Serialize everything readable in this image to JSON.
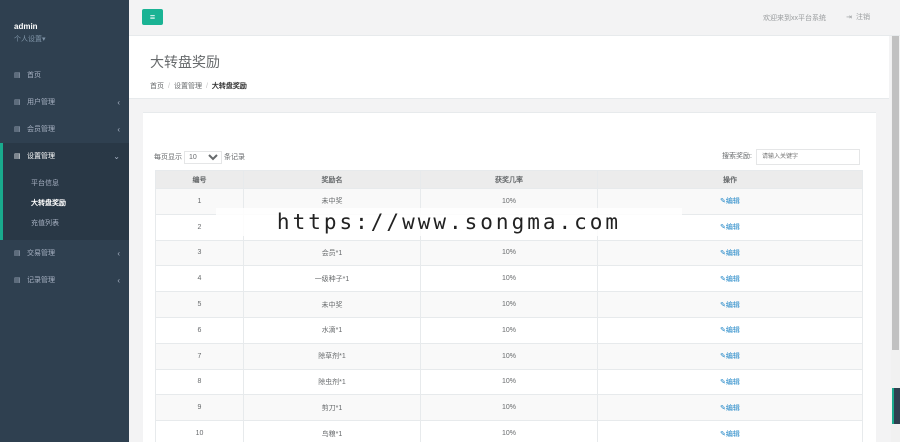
{
  "sidebar": {
    "user": "admin",
    "user_settings": "个人设置▾",
    "items": [
      {
        "label": "首页",
        "has_arrow": false
      },
      {
        "label": "用户管理",
        "has_arrow": true
      },
      {
        "label": "会员管理",
        "has_arrow": true
      },
      {
        "label": "设置管理",
        "active": true
      },
      {
        "label": "交易管理",
        "has_arrow": true
      },
      {
        "label": "记录管理",
        "has_arrow": true
      }
    ],
    "submenu": [
      {
        "label": "平台信息"
      },
      {
        "label": "大转盘奖励",
        "active": true
      },
      {
        "label": "充值列表"
      }
    ],
    "arrow_closed": "‹",
    "arrow_open": "⌄",
    "item_icon": "▤"
  },
  "topbar": {
    "menu_icon": "≡",
    "welcome": "欢迎来到xx平台系统",
    "logout_icon": "⇥",
    "logout": "注销"
  },
  "heading": {
    "title": "大转盘奖励",
    "breadcrumb": [
      "首页",
      "设置管理",
      "大转盘奖励"
    ]
  },
  "table_controls": {
    "length_prefix": "每页显示",
    "length_value": "10",
    "length_suffix": "条记录",
    "search_label": "搜索奖励:",
    "search_placeholder": "请输入关键字"
  },
  "table": {
    "headers": [
      "编号",
      "奖励名",
      "获奖几率",
      "操作"
    ],
    "edit_label": "✎编辑",
    "rows": [
      {
        "id": "1",
        "name": "未中奖",
        "rate": "10%"
      },
      {
        "id": "2",
        "name": "",
        "rate": ""
      },
      {
        "id": "3",
        "name": "会员*1",
        "rate": "10%"
      },
      {
        "id": "4",
        "name": "一级种子*1",
        "rate": "10%"
      },
      {
        "id": "5",
        "name": "未中奖",
        "rate": "10%"
      },
      {
        "id": "6",
        "name": "水滴*1",
        "rate": "10%"
      },
      {
        "id": "7",
        "name": "除草剂*1",
        "rate": "10%"
      },
      {
        "id": "8",
        "name": "除虫剂*1",
        "rate": "10%"
      },
      {
        "id": "9",
        "name": "剪刀*1",
        "rate": "10%"
      },
      {
        "id": "10",
        "name": "鸟粮*1",
        "rate": "10%"
      }
    ]
  },
  "watermark": "https://www.songma.com",
  "colors": {
    "sidebar_bg": "#2f4050",
    "accent": "#1ab394",
    "link": "#1c84c6"
  }
}
